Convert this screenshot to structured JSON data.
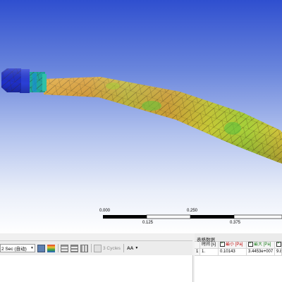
{
  "scale": {
    "ticks_top": [
      "0.000",
      "0.250"
    ],
    "ticks_bottom": [
      "0.125",
      "0.375"
    ]
  },
  "toolbar": {
    "time_select": "2 Sec (自动)",
    "cycles_label": "3 Cycles",
    "aa_label": "AA"
  },
  "table": {
    "title": "表格数据",
    "headers": [
      "时间 [s]",
      "最小 [Pa]",
      "最大 [Pa]"
    ],
    "rows": [
      {
        "index": "1",
        "time": "1.",
        "min": "0.10143",
        "max": "3.4453e+007",
        "extra": "9.8"
      }
    ]
  },
  "colors": {
    "model_orange": "#d79a32",
    "model_yellow": "#c9cf3a",
    "model_green": "#6ec23a",
    "tip_blue": "#1e2fc8"
  }
}
